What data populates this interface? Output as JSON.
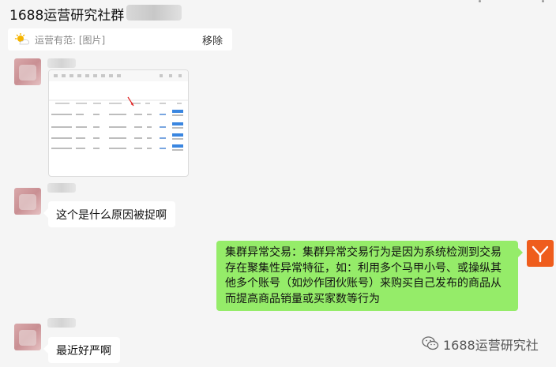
{
  "chat": {
    "title": "1688运营研究社群"
  },
  "notice": {
    "text": "运营有范: [图片]",
    "action_label": "移除"
  },
  "messages": [
    {
      "kind": "image",
      "side": "left"
    },
    {
      "kind": "text",
      "side": "left",
      "text": "这个是什么原因被捉啊"
    },
    {
      "kind": "text",
      "side": "right",
      "text": "集群异常交易：集群异常交易行为是因为系统检测到交易存在聚集性异常特征，如：利用多个马甲小号、或操纵其他多个账号（如炒作团伙账号）来购买自己发布的商品从而提高商品销量或买家数等行为"
    },
    {
      "kind": "text",
      "side": "left",
      "text": "最近好严啊"
    }
  ],
  "watermark": {
    "text": "1688运营研究社"
  },
  "colors": {
    "my_bubble": "#95ec69",
    "their_bubble": "#ffffff",
    "background": "#f5f5f5",
    "self_avatar": "#ef5d1d"
  }
}
